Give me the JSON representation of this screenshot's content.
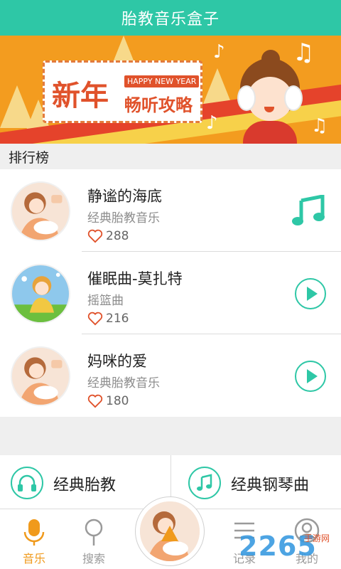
{
  "header": {
    "title": "胎教音乐盒子"
  },
  "banner": {
    "title_big": "新年",
    "happy_tag": "HAPPY NEW YEAR",
    "title_sub": "畅听攻略"
  },
  "section": {
    "title": "排行榜"
  },
  "songs": [
    {
      "title": "静谧的海底",
      "subtitle": "经典胎教音乐",
      "likes": "288",
      "state": "playing"
    },
    {
      "title": "催眠曲-莫扎特",
      "subtitle": "摇篮曲",
      "likes": "216",
      "state": "paused"
    },
    {
      "title": "妈咪的爱",
      "subtitle": "经典胎教音乐",
      "likes": "180",
      "state": "paused"
    }
  ],
  "categories": [
    {
      "label": "经典胎教",
      "icon": "headphones-icon"
    },
    {
      "label": "经典钢琴曲",
      "icon": "music-note-icon"
    }
  ],
  "nav": {
    "tabs": [
      {
        "label": "音乐",
        "icon": "microphone-icon",
        "active": true
      },
      {
        "label": "搜索",
        "icon": "search-icon",
        "active": false
      },
      {
        "label": "记录",
        "icon": "list-icon",
        "active": false
      },
      {
        "label": "我的",
        "icon": "user-icon",
        "active": false
      }
    ]
  },
  "watermark": {
    "text": "2265",
    "sub": "手游网"
  },
  "colors": {
    "accent": "#2ec7a6",
    "active_tab": "#f09a1c",
    "banner_bg": "#f39c1f"
  }
}
